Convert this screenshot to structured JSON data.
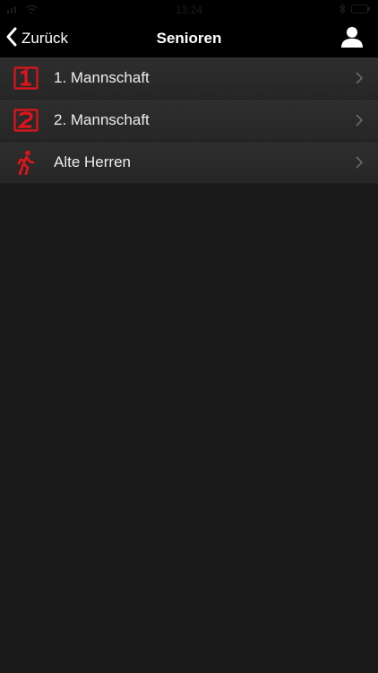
{
  "status_bar": {
    "time": "13:24"
  },
  "nav": {
    "back_label": "Zurück",
    "title": "Senioren",
    "back_icon": "chevron-left-icon",
    "profile_icon": "person-icon"
  },
  "teams": [
    {
      "label": "1. Mannschaft",
      "icon": "number-one-icon"
    },
    {
      "label": "2. Mannschaft",
      "icon": "number-two-icon"
    },
    {
      "label": "Alte Herren",
      "icon": "walking-person-icon"
    }
  ],
  "colors": {
    "accent": "#e0141b",
    "background": "#1a1a1a",
    "row_background": "#2b2b2b",
    "nav_background": "#000000"
  }
}
